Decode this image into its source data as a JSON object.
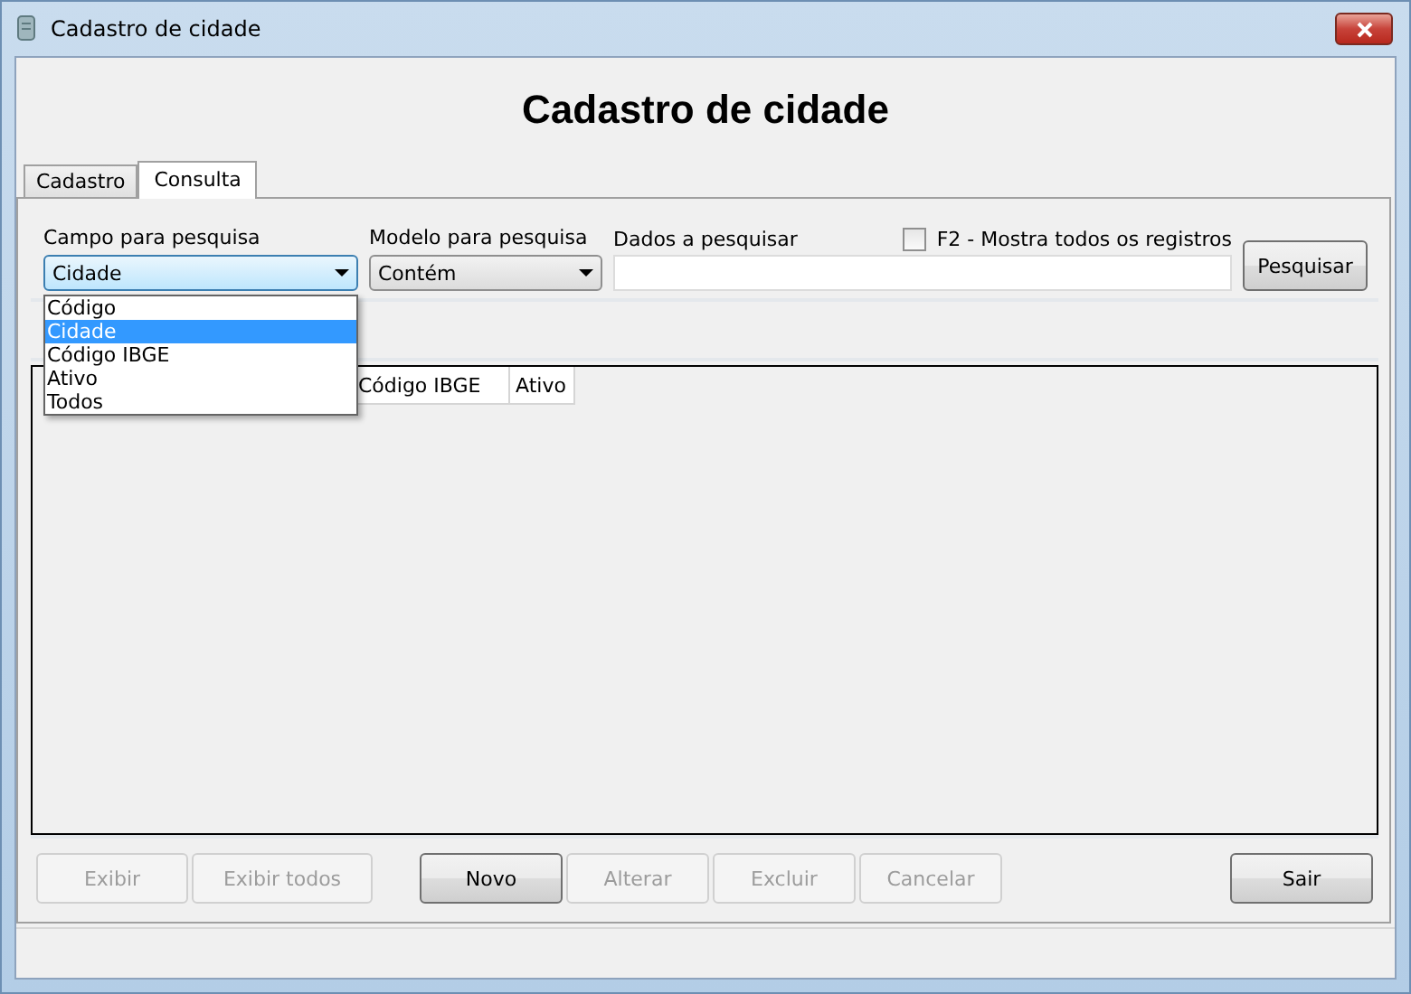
{
  "window": {
    "title": "Cadastro de cidade"
  },
  "heading": "Cadastro de cidade",
  "tabs": [
    {
      "label": "Cadastro",
      "selected": false
    },
    {
      "label": "Consulta",
      "selected": true
    }
  ],
  "search": {
    "field_label": "Campo para pesquisa",
    "field_value": "Cidade",
    "model_label": "Modelo para pesquisa",
    "model_value": "Contém",
    "data_label": "Dados a pesquisar",
    "show_all": {
      "label": "F2 - Mostra todos os registros",
      "checked": false
    },
    "button": {
      "label": "Pesquisar",
      "disabled": false
    },
    "dropdown": {
      "expanded": true,
      "options": [
        {
          "label": "Código",
          "selected": false
        },
        {
          "label": "Cidade",
          "selected": true
        },
        {
          "label": "Código IBGE",
          "selected": false
        },
        {
          "label": "Ativo",
          "selected": false
        },
        {
          "label": "Todos",
          "selected": false
        }
      ]
    }
  },
  "table": {
    "columns": [
      "Código IBGE",
      "Ativo"
    ]
  },
  "actions": {
    "groups": [
      [
        {
          "label": "Exibir",
          "disabled": true
        },
        {
          "label": "Exibir todos",
          "disabled": true
        }
      ],
      [
        {
          "label": "Novo",
          "disabled": false
        },
        {
          "label": "Alterar",
          "disabled": true
        },
        {
          "label": "Excluir",
          "disabled": true
        },
        {
          "label": "Cancelar",
          "disabled": true
        }
      ]
    ],
    "exit": {
      "label": "Sair",
      "disabled": false
    }
  }
}
